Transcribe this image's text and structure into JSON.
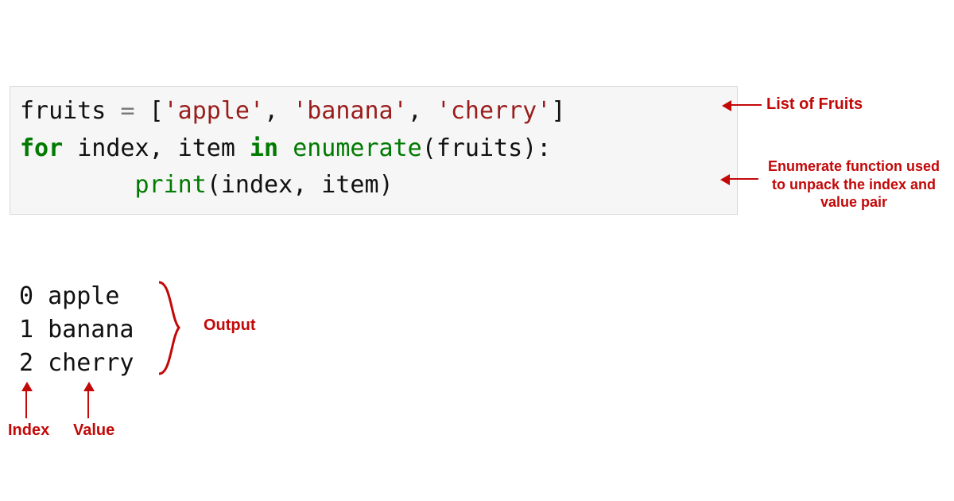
{
  "code": {
    "line1": {
      "var": "fruits",
      "sp1": " ",
      "eq": "=",
      "sp2": " ",
      "lbr": "[",
      "s1": "'apple'",
      "c1": ", ",
      "s2": "'banana'",
      "c2": ", ",
      "s3": "'cherry'",
      "rbr": "]"
    },
    "line2_blank": "",
    "line3": {
      "kw_for": "for",
      "mid": " index, item ",
      "kw_in": "in",
      "sp": " ",
      "fn": "enumerate",
      "lp": "(",
      "arg": "fruits",
      "rp": ")",
      "colon": ":"
    },
    "line4": {
      "indent": "        ",
      "fn": "print",
      "lp": "(",
      "args": "index, item",
      "rp": ")"
    }
  },
  "output": {
    "l1": "0 apple",
    "l2": "1 banana",
    "l3": "2 cherry"
  },
  "annotations": {
    "list": "List of Fruits",
    "enum": "Enumerate function used to unpack the index and value pair",
    "output": "Output",
    "index": "Index",
    "value": "Value"
  },
  "chart_data": {
    "type": "table",
    "title": "Python enumerate example",
    "columns": [
      "index",
      "value"
    ],
    "rows": [
      [
        0,
        "apple"
      ],
      [
        1,
        "banana"
      ],
      [
        2,
        "cherry"
      ]
    ],
    "fruits_list": [
      "apple",
      "banana",
      "cherry"
    ]
  }
}
